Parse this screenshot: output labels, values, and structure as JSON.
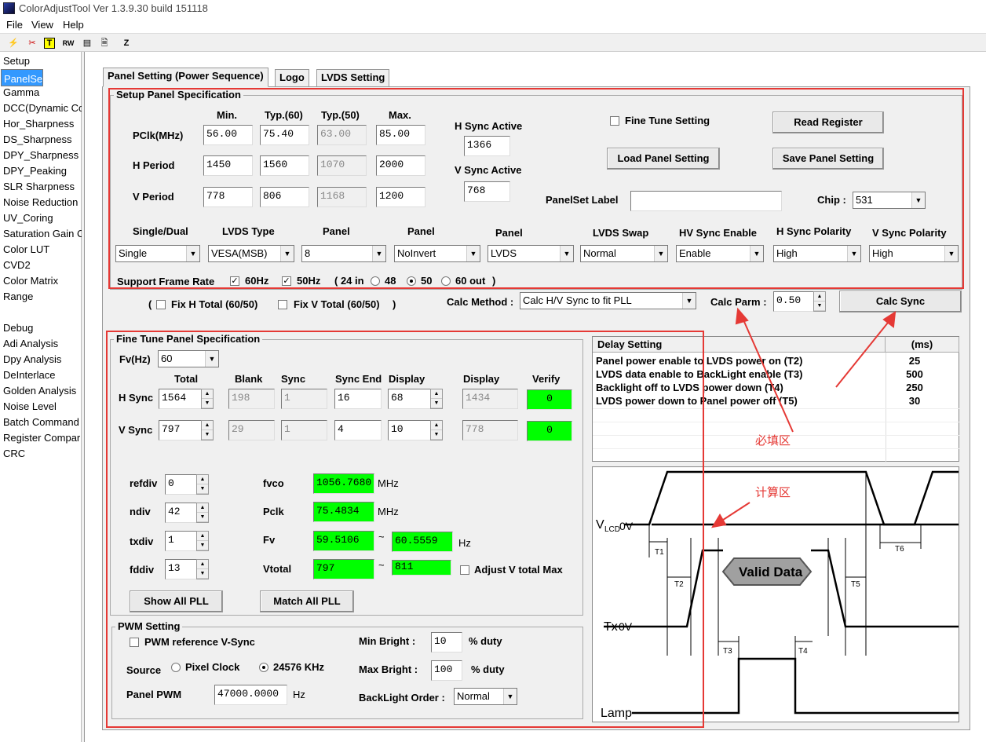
{
  "window": {
    "title": "ColorAdjustTool Ver 1.3.9.30 build 151118"
  },
  "menu": [
    "File",
    "View",
    "Help"
  ],
  "toolbar": {
    "icons": [
      "wand-icon",
      "cut-icon",
      "t-icon",
      "rw-icon",
      "register-icon",
      "document-icon",
      "z-icon"
    ],
    "labels": [
      "T",
      "RW",
      "Z"
    ]
  },
  "nav": [
    "Setup",
    "PanelSet",
    "Gamma",
    "DCC(Dynamic Co",
    "Hor_Sharpness",
    "DS_Sharpness",
    "DPY_Sharpness",
    "DPY_Peaking",
    "SLR Sharpness",
    "Noise Reduction",
    "UV_Coring",
    "Saturation Gain C",
    "Color LUT",
    "CVD2",
    "Color Matrix",
    "Range",
    "",
    "Debug",
    "Adi Analysis",
    "Dpy Analysis",
    "DeInterlace",
    "Golden Analysis",
    "Noise Level",
    "Batch Command",
    "Register Compar",
    "CRC"
  ],
  "tabs": [
    "Panel Setting (Power Sequence)",
    "Logo",
    "LVDS Setting"
  ],
  "setup": {
    "title": "Setup Panel Specification",
    "col_headers": [
      "Min.",
      "Typ.(60)",
      "Typ.(50)",
      "Max."
    ],
    "rows": [
      {
        "label": "PClk(MHz)",
        "values": [
          "56.00",
          "75.40",
          "63.00",
          "85.00"
        ]
      },
      {
        "label": "H Period",
        "values": [
          "1450",
          "1560",
          "1070",
          "2000"
        ]
      },
      {
        "label": "V Period",
        "values": [
          "778",
          "806",
          "1168",
          "1200"
        ]
      }
    ],
    "hsync_active_label": "H Sync Active",
    "hsync_active": "1366",
    "vsync_active_label": "V Sync Active",
    "vsync_active": "768",
    "fine_tune_label": "Fine Tune Setting",
    "read_register": "Read Register",
    "load_panel": "Load Panel Setting",
    "save_panel": "Save Panel Setting",
    "panelset_label": "PanelSet Label",
    "panelset_value": "",
    "chip_label": "Chip :",
    "chip_value": "531",
    "dropdowns": [
      {
        "label": "Single/Dual",
        "value": "Single"
      },
      {
        "label": "LVDS Type",
        "value": "VESA(MSB)"
      },
      {
        "label": "Panel",
        "value": "8"
      },
      {
        "label": "Panel",
        "value": "NoInvert"
      },
      {
        "label": "Panel",
        "value": "LVDS"
      },
      {
        "label": "LVDS Swap",
        "value": "Normal"
      },
      {
        "label": "HV Sync Enable",
        "value": "Enable"
      },
      {
        "label": "H Sync Polarity",
        "value": "High"
      },
      {
        "label": "V Sync Polarity",
        "value": "High"
      }
    ],
    "frame_rate_label": "Support Frame Rate",
    "fr60": "60Hz",
    "fr50": "50Hz",
    "fr_in": "( 24 in",
    "fr48": "48",
    "fr50b": "50",
    "fr60out": "60 out",
    "fr_close": ")"
  },
  "fix": {
    "open": "(",
    "h": "Fix  H Total (60/50)",
    "v": "Fix  V Total (60/50)",
    "close": ")"
  },
  "calc": {
    "method_label": "Calc Method :",
    "method_value": "Calc H/V Sync to fit PLL",
    "parm_label": "Calc Parm :",
    "parm_value": "0.50",
    "button": "Calc Sync"
  },
  "fine": {
    "title": "Fine Tune Panel Specification",
    "fv_label": "Fv(Hz)",
    "fv_value": "60",
    "headers": [
      "Total",
      "Blank",
      "Sync",
      "Sync End",
      "Display",
      "Display",
      "Verify"
    ],
    "hsync": {
      "label": "H Sync",
      "total": "1564",
      "blank": "198",
      "sync": "1",
      "sync_end": "16",
      "display": "68",
      "display2": "1434",
      "verify": "0"
    },
    "vsync": {
      "label": "V Sync",
      "total": "797",
      "blank": "29",
      "sync": "1",
      "sync_end": "4",
      "display": "10",
      "display2": "778",
      "verify": "0"
    },
    "refdiv_label": "refdiv",
    "refdiv": "0",
    "ndiv_label": "ndiv",
    "ndiv": "42",
    "txdiv_label": "txdiv",
    "txdiv": "1",
    "fddiv_label": "fddiv",
    "fddiv": "13",
    "fvco_label": "fvco",
    "fvco": "1056.7680",
    "fvco_unit": "MHz",
    "pclk_label": "Pclk",
    "pclk": "75.4834",
    "pclk_unit": "MHz",
    "fv2_label": "Fv",
    "fv_min": "59.5106",
    "fv_max": "60.5559",
    "fv_unit": "Hz",
    "vtotal_label": "Vtotal",
    "vtotal_min": "797",
    "vtotal_max": "811",
    "tilde": "~",
    "adjust_label": "Adjust V total Max",
    "show_pll": "Show All PLL",
    "match_pll": "Match All PLL"
  },
  "pwm": {
    "title": "PWM Setting",
    "ref_label": "PWM reference V-Sync",
    "source_label": "Source",
    "pixel_clock": "Pixel Clock",
    "khz": "24576 KHz",
    "panel_pwm_label": "Panel PWM",
    "panel_pwm": "47000.0000",
    "hz": "Hz",
    "min_bright_label": "Min Bright :",
    "min_bright": "10",
    "duty": "% duty",
    "max_bright_label": "Max Bright :",
    "max_bright": "100",
    "backlight_label": "BackLight Order :",
    "backlight": "Normal"
  },
  "delay": {
    "headers": [
      "Delay Setting",
      "(ms)"
    ],
    "rows": [
      {
        "label": "Panel power enable to LVDS power on (T2)",
        "value": "25"
      },
      {
        "label": "LVDS data enable to BackLight enable (T3)",
        "value": "500"
      },
      {
        "label": "Backlight off to LVDS power down (T4)",
        "value": "250"
      },
      {
        "label": "LVDS power down to Panel power off (T5)",
        "value": "30"
      }
    ]
  },
  "annotations": {
    "required": "必填区",
    "calc": "计算区"
  },
  "timing": {
    "vlcd": "V",
    "vlcd_sub": "LCD",
    "zero_v": "0V",
    "tx": "Tx",
    "lamp": "Lamp",
    "valid": "Valid Data",
    "t": [
      "T1",
      "T2",
      "T3",
      "T4",
      "T5",
      "T6"
    ]
  },
  "colors": {
    "accent": "#3399ff",
    "red": "#e53935",
    "green": "#00ff00"
  }
}
